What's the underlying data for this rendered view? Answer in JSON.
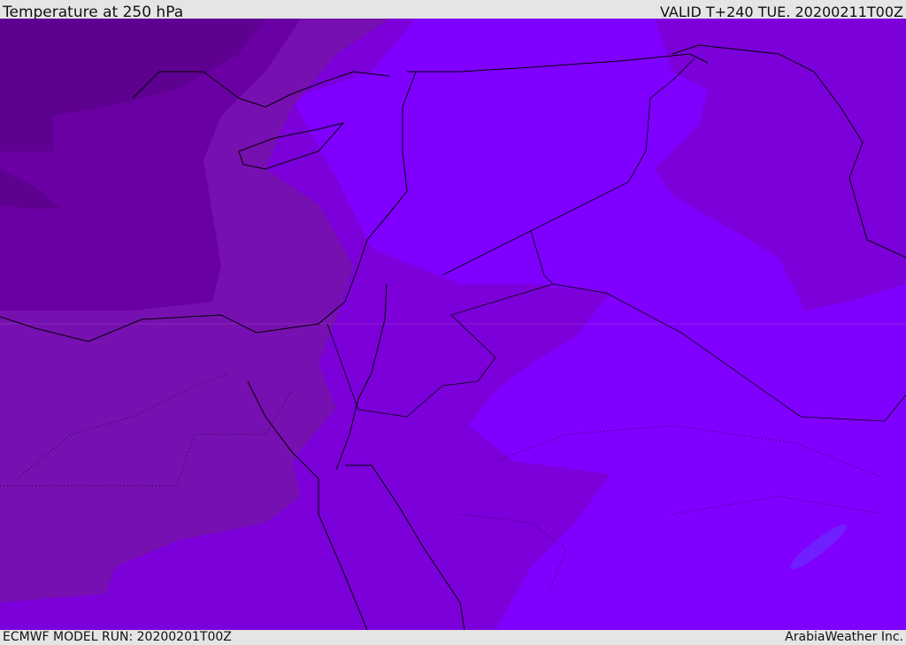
{
  "header": {
    "title": "Temperature at 250 hPa",
    "valid": "VALID T+240 TUE. 20200211T00Z"
  },
  "footer": {
    "model_run": "ECMWF MODEL RUN: 20200201T00Z",
    "credit": "ArabiaWeather Inc."
  },
  "map": {
    "variable": "Temperature",
    "level": "250 hPa",
    "colors": {
      "coldest": "#5e0090",
      "cold": "#6a00a4",
      "mid": "#7610b0",
      "warm": "#7c00da",
      "warmest": "#7f00ff",
      "outline": "#000000"
    }
  }
}
